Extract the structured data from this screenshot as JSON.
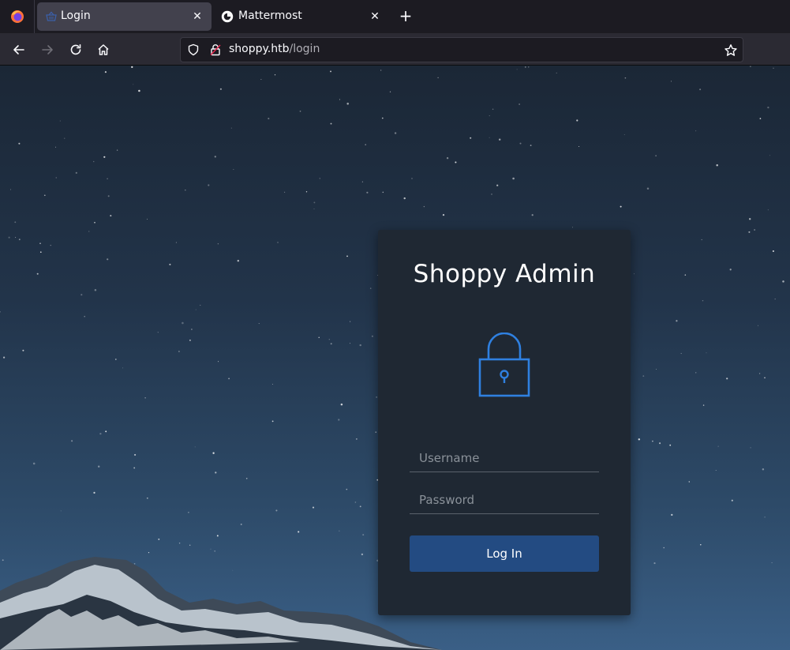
{
  "browser": {
    "tabs": [
      {
        "title": "Login",
        "icon": "basket-icon",
        "active": true
      },
      {
        "title": "Mattermost",
        "icon": "mattermost-icon",
        "active": false
      }
    ],
    "url": {
      "host": "shoppy.htb",
      "path": "/login"
    }
  },
  "login": {
    "title": "Shoppy Admin",
    "username_placeholder": "Username",
    "password_placeholder": "Password",
    "button_label": "Log In"
  },
  "colors": {
    "accent": "#2f80e0",
    "button": "#234b82",
    "card": "#1f2833"
  }
}
